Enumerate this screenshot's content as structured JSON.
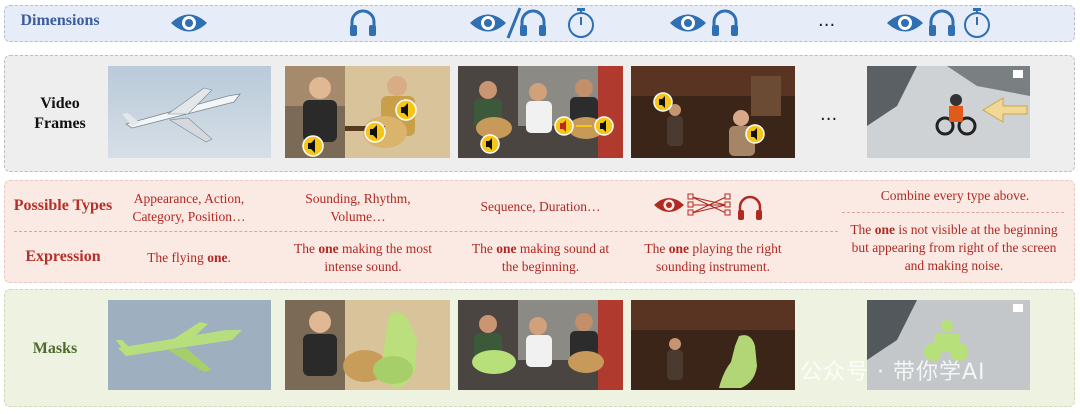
{
  "rows": {
    "dimensions": "Dimensions",
    "video_frames": "Video\nFrames",
    "possible_types": "Possible Types",
    "expression": "Expression",
    "masks": "Masks"
  },
  "columns": [
    {
      "icons": [
        "eye-icon"
      ],
      "types": "Appearance, Action,\nCategory, Position…",
      "expression_pre": "The flying ",
      "expression_bold": "one",
      "expression_post": "."
    },
    {
      "icons": [
        "headphones-icon"
      ],
      "types": "Sounding, Rhythm,\nVolume…",
      "expression_pre": "The ",
      "expression_bold": "one",
      "expression_post": " making the most\nintense sound."
    },
    {
      "icons": [
        "eye-icon",
        "slash",
        "headphones-icon",
        "stopwatch-icon"
      ],
      "types": "Sequence, Duration…",
      "expression_pre": "The ",
      "expression_bold": "one",
      "expression_post": " making sound at\nthe beginning."
    },
    {
      "icons": [
        "eye-icon",
        "headphones-icon"
      ],
      "types": "",
      "expression_pre": "The ",
      "expression_bold": "one",
      "expression_post": " playing the right\nsounding instrument."
    },
    {
      "icons": [
        "eye-icon",
        "headphones-icon",
        "stopwatch-icon"
      ],
      "types": "Combine every type above.",
      "expression_pre": "The ",
      "expression_bold": "one",
      "expression_post": " is not visible at the beginning\nbut appearing from right of the screen\nand making noise."
    }
  ],
  "ellipsis": "...",
  "watermark": "公众号 · 带你学AI",
  "colors": {
    "blue": "#2f6fb3",
    "red": "#b02a22",
    "green_mask": "#b8e07a",
    "label_blue": "#3b5da0"
  }
}
